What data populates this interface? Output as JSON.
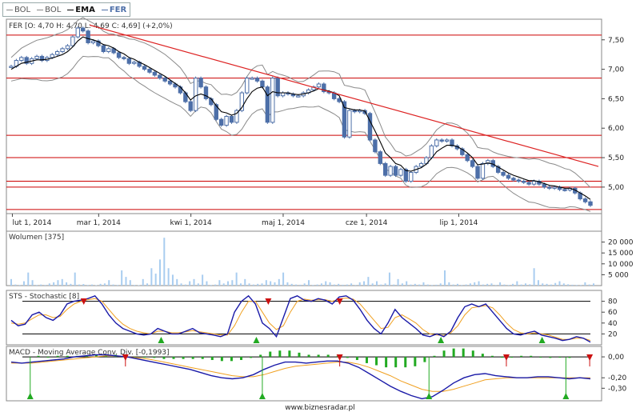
{
  "legend": [
    {
      "label": "BOL",
      "style": "normal"
    },
    {
      "label": "BOL",
      "style": "normal"
    },
    {
      "label": "EMA",
      "style": "bold"
    },
    {
      "label": "FER",
      "style": "blue"
    }
  ],
  "footer": "www.biznesradar.pl",
  "colors": {
    "candle": "#4d6fa8",
    "volume": "#a9cdf0",
    "ema": "#000000",
    "bollinger": "#8a8a8a",
    "hline": "#cc0000",
    "trend": "#dd2222",
    "stoch_k": "#1a1aa8",
    "stoch_d": "#f0a020",
    "macd": "#1a1aa8",
    "signal": "#f0a020",
    "hist": "#22aa22",
    "arrow_up": "#22aa22",
    "arrow_down": "#cc1111"
  },
  "chart_data": [
    {
      "type": "candlestick",
      "title": "FER [O: 4,70  H: 4,70  L: 4,69  C: 4,69] (+2,0%)",
      "x_tick_labels": [
        "lut 1, 2014",
        "mar 1, 2014",
        "kwi 1, 2014",
        "maj 1, 2014",
        "cze 1, 2014",
        "lip 1, 2014"
      ],
      "y_tick_labels": [
        "7,50",
        "7,00",
        "6,50",
        "6,00",
        "5,50",
        "5,00"
      ],
      "ylim": [
        4.55,
        7.85
      ],
      "horizontal_levels": [
        7.58,
        6.85,
        5.88,
        5.5,
        5.1,
        5.0,
        4.62
      ],
      "trendline": {
        "start": [
          0,
          7.75
        ],
        "end": [
          1,
          5.35
        ]
      },
      "close": [
        7.05,
        7.15,
        7.2,
        7.1,
        7.18,
        7.22,
        7.15,
        7.2,
        7.25,
        7.3,
        7.35,
        7.4,
        7.55,
        7.7,
        7.65,
        7.45,
        7.48,
        7.4,
        7.3,
        7.35,
        7.28,
        7.2,
        7.18,
        7.1,
        7.12,
        7.05,
        7.0,
        6.95,
        6.9,
        6.85,
        6.8,
        6.75,
        6.7,
        6.6,
        6.45,
        6.3,
        6.85,
        6.7,
        6.5,
        6.4,
        6.15,
        6.05,
        6.2,
        6.1,
        6.3,
        6.6,
        6.85,
        6.85,
        6.8,
        6.7,
        6.1,
        6.85,
        6.55,
        6.6,
        6.58,
        6.55,
        6.55,
        6.6,
        6.65,
        6.7,
        6.75,
        6.62,
        6.6,
        6.5,
        6.45,
        5.85,
        6.3,
        6.28,
        6.3,
        6.25,
        5.8,
        5.6,
        5.4,
        5.2,
        5.35,
        5.2,
        5.3,
        5.1,
        5.25,
        5.35,
        5.4,
        5.5,
        5.7,
        5.8,
        5.78,
        5.8,
        5.7,
        5.65,
        5.55,
        5.45,
        5.35,
        5.15,
        5.4,
        5.45,
        5.35,
        5.25,
        5.2,
        5.15,
        5.12,
        5.1,
        5.08,
        5.05,
        5.1,
        5.05,
        5.0,
        4.98,
        5.0,
        4.96,
        4.95,
        4.98,
        4.9,
        4.8,
        4.75,
        4.69
      ],
      "ema": [
        7.0,
        7.05,
        7.1,
        7.12,
        7.14,
        7.16,
        7.16,
        7.17,
        7.19,
        7.22,
        7.25,
        7.3,
        7.38,
        7.48,
        7.55,
        7.52,
        7.5,
        7.47,
        7.42,
        7.4,
        7.36,
        7.3,
        7.26,
        7.2,
        7.17,
        7.12,
        7.08,
        7.03,
        6.98,
        6.93,
        6.88,
        6.82,
        6.76,
        6.7,
        6.6,
        6.48,
        6.55,
        6.58,
        6.55,
        6.5,
        6.38,
        6.28,
        6.26,
        6.22,
        6.25,
        6.35,
        6.5,
        6.62,
        6.68,
        6.7,
        6.55,
        6.62,
        6.6,
        6.6,
        6.6,
        6.58,
        6.57,
        6.58,
        6.6,
        6.63,
        6.67,
        6.65,
        6.63,
        6.6,
        6.55,
        6.35,
        6.33,
        6.31,
        6.31,
        6.29,
        6.12,
        5.95,
        5.77,
        5.58,
        5.5,
        5.4,
        5.37,
        5.28,
        5.27,
        5.3,
        5.33,
        5.39,
        5.49,
        5.6,
        5.66,
        5.71,
        5.71,
        5.69,
        5.64,
        5.58,
        5.5,
        5.38,
        5.39,
        5.41,
        5.39,
        5.34,
        5.29,
        5.24,
        5.2,
        5.17,
        5.14,
        5.11,
        5.11,
        5.09,
        5.06,
        5.03,
        5.02,
        5.0,
        4.98,
        4.98,
        4.95,
        4.9,
        4.85,
        4.79
      ]
    },
    {
      "type": "bar",
      "title": "Wolumen [375]",
      "y_tick_labels": [
        "20 000",
        "15 000",
        "10 000",
        "5 000"
      ],
      "ylim": [
        0,
        25000
      ],
      "values": [
        3000,
        500,
        300,
        2000,
        6000,
        2500,
        300,
        500,
        300,
        1000,
        1500,
        2500,
        3000,
        1500,
        800,
        6000,
        500,
        700,
        300,
        500,
        200,
        800,
        1000,
        2500,
        500,
        300,
        7000,
        4000,
        2500,
        300,
        200,
        3000,
        1000,
        8000,
        5500,
        12000,
        22000,
        8000,
        5000,
        3000,
        1000,
        500,
        2000,
        3000,
        1000,
        5000,
        2000,
        300,
        500,
        2500,
        1000,
        2000,
        2500,
        6000,
        1000,
        3000,
        1000,
        500,
        800,
        1000,
        2500,
        2000,
        1500,
        3000,
        6000,
        1500,
        800,
        500,
        400,
        1000,
        2500,
        300,
        500,
        1000,
        2000,
        1500,
        500,
        800,
        400,
        500,
        1000,
        300,
        1500,
        2000,
        4000,
        1000,
        2000,
        500,
        1000,
        6000,
        500,
        3000,
        1000,
        2000,
        500,
        800,
        500,
        1500,
        500,
        300,
        400,
        1000,
        7000,
        1500,
        500,
        800,
        300,
        500,
        1000,
        1500,
        2000,
        500,
        800,
        1000,
        300,
        1500,
        500,
        300,
        800,
        2000,
        500,
        1000,
        600,
        8000,
        2500,
        1000,
        800,
        500,
        1200,
        2000,
        1000,
        600,
        400,
        300,
        300,
        1500,
        500,
        1000
      ]
    },
    {
      "type": "line",
      "title": "STS - Stochastic [8]",
      "y_tick_labels": [
        "80",
        "60",
        "40",
        "20"
      ],
      "ylim": [
        0,
        100
      ],
      "levels": [
        80,
        20
      ],
      "series": [
        {
          "name": "K",
          "values": [
            45,
            35,
            38,
            55,
            60,
            50,
            45,
            55,
            75,
            80,
            82,
            85,
            90,
            75,
            55,
            40,
            30,
            25,
            20,
            18,
            20,
            30,
            25,
            20,
            20,
            25,
            30,
            22,
            20,
            18,
            15,
            20,
            60,
            80,
            90,
            75,
            40,
            30,
            15,
            50,
            85,
            90,
            82,
            80,
            85,
            82,
            75,
            88,
            90,
            82,
            65,
            45,
            30,
            20,
            40,
            65,
            50,
            40,
            30,
            18,
            15,
            20,
            15,
            25,
            50,
            70,
            75,
            70,
            75,
            60,
            45,
            30,
            20,
            18,
            22,
            25,
            18,
            15,
            12,
            8,
            10,
            15,
            12,
            5
          ]
        },
        {
          "name": "D",
          "values": [
            40,
            38,
            40,
            48,
            55,
            55,
            50,
            52,
            65,
            75,
            80,
            83,
            85,
            80,
            65,
            50,
            38,
            30,
            25,
            22,
            20,
            25,
            25,
            22,
            22,
            24,
            26,
            24,
            22,
            20,
            18,
            18,
            35,
            60,
            80,
            80,
            60,
            40,
            28,
            35,
            60,
            80,
            84,
            82,
            83,
            83,
            80,
            84,
            86,
            84,
            75,
            60,
            45,
            30,
            32,
            50,
            55,
            48,
            40,
            28,
            20,
            18,
            17,
            22,
            35,
            55,
            68,
            70,
            72,
            68,
            55,
            40,
            28,
            22,
            20,
            22,
            20,
            18,
            14,
            10,
            10,
            12,
            12,
            8
          ]
        }
      ],
      "signals_down_at": [
        0.13,
        0.44,
        0.56
      ],
      "signals_up_at": [
        0.26,
        0.42,
        0.73,
        0.9
      ]
    },
    {
      "type": "line",
      "title": "MACD - Moving Average Conv. Div. [-0,1993]",
      "y_tick_labels": [
        "0,00",
        "-0,20",
        "-0,30"
      ],
      "ylim": [
        -0.42,
        0.1
      ],
      "series": [
        {
          "name": "MACD",
          "values": [
            -0.05,
            -0.06,
            -0.05,
            -0.04,
            -0.03,
            -0.02,
            0.0,
            0.01,
            0.02,
            0.02,
            0.01,
            0.0,
            -0.02,
            -0.04,
            -0.06,
            -0.08,
            -0.1,
            -0.12,
            -0.15,
            -0.18,
            -0.2,
            -0.21,
            -0.2,
            -0.17,
            -0.12,
            -0.08,
            -0.05,
            -0.05,
            -0.06,
            -0.05,
            -0.04,
            -0.04,
            -0.06,
            -0.1,
            -0.16,
            -0.22,
            -0.28,
            -0.33,
            -0.37,
            -0.4,
            -0.38,
            -0.32,
            -0.25,
            -0.2,
            -0.17,
            -0.16,
            -0.18,
            -0.19,
            -0.2,
            -0.2,
            -0.19,
            -0.19,
            -0.2,
            -0.21,
            -0.2,
            -0.21
          ]
        },
        {
          "name": "Signal",
          "values": [
            -0.06,
            -0.06,
            -0.06,
            -0.05,
            -0.04,
            -0.03,
            -0.02,
            -0.01,
            0.0,
            0.01,
            0.01,
            0.0,
            -0.01,
            -0.02,
            -0.04,
            -0.06,
            -0.08,
            -0.1,
            -0.12,
            -0.14,
            -0.16,
            -0.18,
            -0.19,
            -0.19,
            -0.17,
            -0.14,
            -0.11,
            -0.09,
            -0.08,
            -0.07,
            -0.06,
            -0.05,
            -0.05,
            -0.07,
            -0.1,
            -0.14,
            -0.18,
            -0.23,
            -0.27,
            -0.31,
            -0.33,
            -0.33,
            -0.31,
            -0.28,
            -0.25,
            -0.22,
            -0.21,
            -0.2,
            -0.2,
            -0.2,
            -0.2,
            -0.2,
            -0.2,
            -0.2,
            -0.2,
            -0.2
          ]
        }
      ],
      "histogram": [
        0.01,
        0.0,
        0.01,
        0.01,
        0.01,
        0.01,
        0.02,
        0.02,
        0.02,
        0.01,
        0.0,
        0.0,
        -0.01,
        -0.02,
        -0.02,
        -0.02,
        -0.02,
        -0.02,
        -0.03,
        -0.04,
        -0.04,
        -0.03,
        -0.01,
        0.02,
        0.05,
        0.06,
        0.06,
        0.04,
        0.02,
        0.02,
        0.02,
        0.01,
        -0.01,
        -0.03,
        -0.06,
        -0.08,
        -0.1,
        -0.1,
        -0.1,
        -0.09,
        -0.05,
        0.01,
        0.06,
        0.08,
        0.08,
        0.06,
        0.03,
        0.01,
        0.0,
        0.0,
        0.01,
        0.01,
        0.0,
        -0.01,
        0.0,
        -0.01
      ],
      "signals_down_at": [
        0.2,
        0.56,
        0.84,
        0.98
      ],
      "signals_up_at": [
        0.04,
        0.43,
        0.71,
        0.94
      ]
    }
  ]
}
